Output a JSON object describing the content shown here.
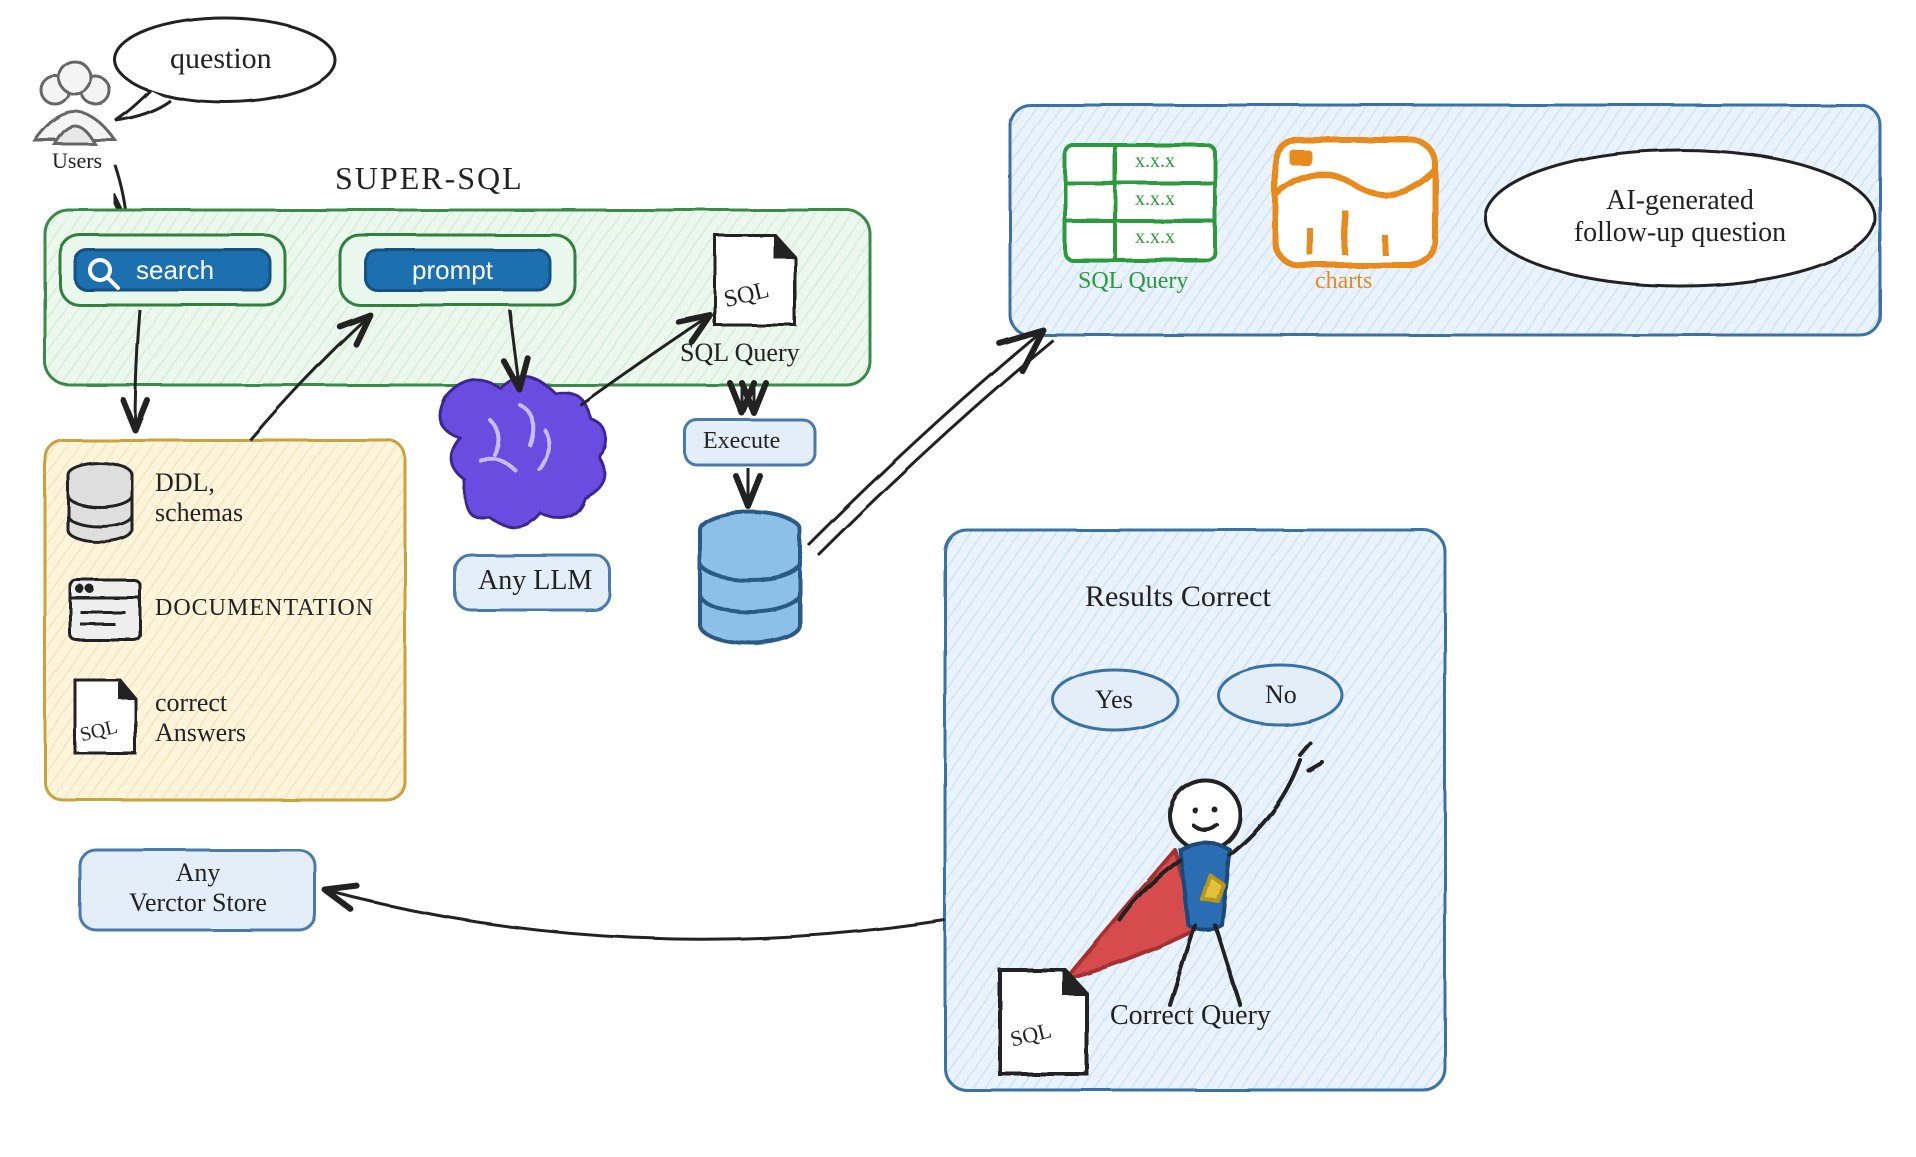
{
  "top": {
    "users_label": "Users",
    "question_bubble": "question"
  },
  "supersql": {
    "title": "SUPER-SQL",
    "search_label": "search",
    "prompt_label": "prompt",
    "sql_icon_text": "SQL",
    "sql_query_label": "SQL Query",
    "execute_label": "Execute",
    "any_llm_label": "Any LLM"
  },
  "kb": {
    "ddl_label": "DDL,\nschemas",
    "documentation_label": "DOCUMENTATION",
    "correct_answers_label": "correct\nAnswers",
    "sql_icon_text": "SQL"
  },
  "vector_store": {
    "label": "Any\nVerctor Store"
  },
  "output_panel": {
    "sql_query_label": "SQL Query",
    "charts_label": "charts",
    "table_cell": "x.x.x",
    "followup_label": "AI-generated\nfollow-up question"
  },
  "results_panel": {
    "title": "Results Correct",
    "yes_label": "Yes",
    "no_label": "No",
    "correct_query_label": "Correct Query",
    "sql_icon_text": "SQL"
  }
}
